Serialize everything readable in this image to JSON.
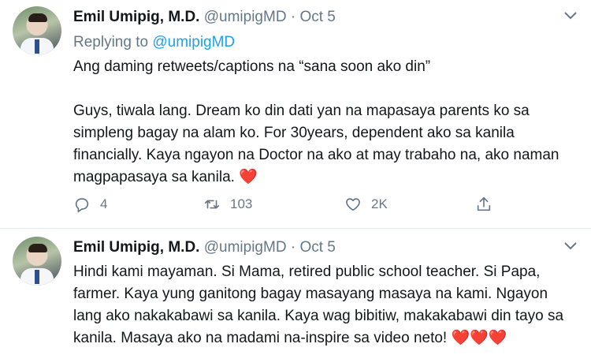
{
  "tweets": [
    {
      "author": {
        "name": "Emil Umipig, M.D.",
        "handle": "@umipigMD",
        "separator": "·",
        "date": "Oct 5"
      },
      "reply_prefix": "Replying to",
      "reply_to": "@umipigMD",
      "paragraphs": [
        "Ang daming retweets/captions na “sana soon ako din”",
        "Guys, tiwala lang. Dream ko din dati yan na mapasaya parents ko sa simpleng bagay na alam ko. For 30years, dependent ako sa kanila financially. Kaya ngayon na Doctor na ako at may trabaho na, ako naman magpapasaya sa kanila."
      ],
      "emoji": "❤️",
      "stats": {
        "replies": "4",
        "retweets": "103",
        "likes": "2K"
      },
      "icons": [
        "chevron-down-icon",
        "reply-icon",
        "retweet-icon",
        "like-icon",
        "share-icon"
      ]
    },
    {
      "author": {
        "name": "Emil Umipig, M.D.",
        "handle": "@umipigMD",
        "separator": "·",
        "date": "Oct 5"
      },
      "paragraphs": [
        "Hindi kami mayaman. Si Mama, retired public school teacher. Si Papa, farmer. Kaya yung ganitong bagay masayang masaya na kami. Ngayon lang ako nakakabawi sa kanila. Kaya wag bibitiw, makakabawi din tayo sa kanila. Masaya ako na madami na-inspire sa video neto!"
      ],
      "emoji": "❤️❤️❤️"
    }
  ]
}
